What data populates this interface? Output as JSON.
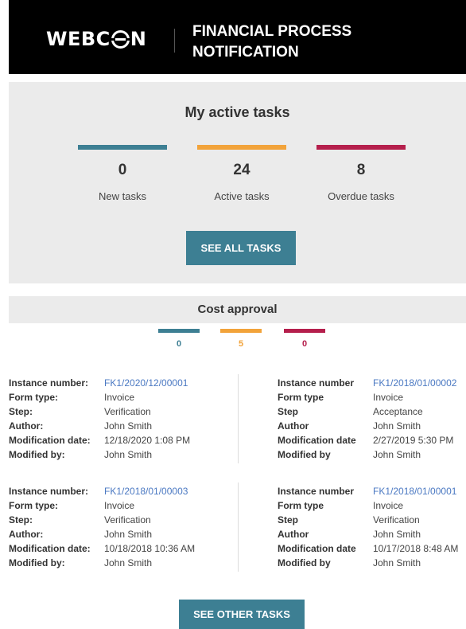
{
  "header": {
    "logo_left": "WEBC",
    "logo_right": "N",
    "title_line1": "FINANCIAL PROCESS",
    "title_line2": "NOTIFICATION"
  },
  "summary": {
    "title": "My active tasks",
    "stats": [
      {
        "value": "0",
        "label": "New tasks",
        "color": "#3d7f93"
      },
      {
        "value": "24",
        "label": "Active tasks",
        "color": "#f2a33a"
      },
      {
        "value": "8",
        "label": "Overdue tasks",
        "color": "#b51f4c"
      }
    ],
    "see_all_label": "SEE ALL TASKS"
  },
  "cost_approval": {
    "title": "Cost approval",
    "counts": [
      {
        "value": "0",
        "color": "#3d7f93"
      },
      {
        "value": "5",
        "color": "#f2a33a"
      },
      {
        "value": "0",
        "color": "#b51f4c"
      }
    ],
    "tasks": [
      {
        "labels": [
          "Instance number:",
          "Form type:",
          "Step:",
          "Author:",
          "Modification date:",
          "Modified by:"
        ],
        "values": [
          "FK1/2020/12/00001",
          "Invoice",
          "Verification",
          "John Smith",
          "12/18/2020 1:08 PM",
          "John Smith"
        ]
      },
      {
        "labels": [
          "Instance number",
          "Form type",
          "Step",
          "Author",
          "Modification date",
          "Modified by"
        ],
        "values": [
          "FK1/2018/01/00002",
          "Invoice",
          "Acceptance",
          "John Smith",
          "2/27/2019 5:30 PM",
          "John Smith"
        ]
      },
      {
        "labels": [
          "Instance number:",
          "Form type:",
          "Step:",
          "Author:",
          "Modification date:",
          "Modified by:"
        ],
        "values": [
          "FK1/2018/01/00003",
          "Invoice",
          "Verification",
          "John Smith",
          "10/18/2018 10:36 AM",
          "John Smith"
        ]
      },
      {
        "labels": [
          "Instance number",
          "Form type",
          "Step",
          "Author",
          "Modification date",
          "Modified by"
        ],
        "values": [
          "FK1/2018/01/00001",
          "Invoice",
          "Verification",
          "John Smith",
          "10/17/2018 8:48 AM",
          "John Smith"
        ]
      }
    ],
    "see_other_label": "SEE OTHER TASKS"
  }
}
